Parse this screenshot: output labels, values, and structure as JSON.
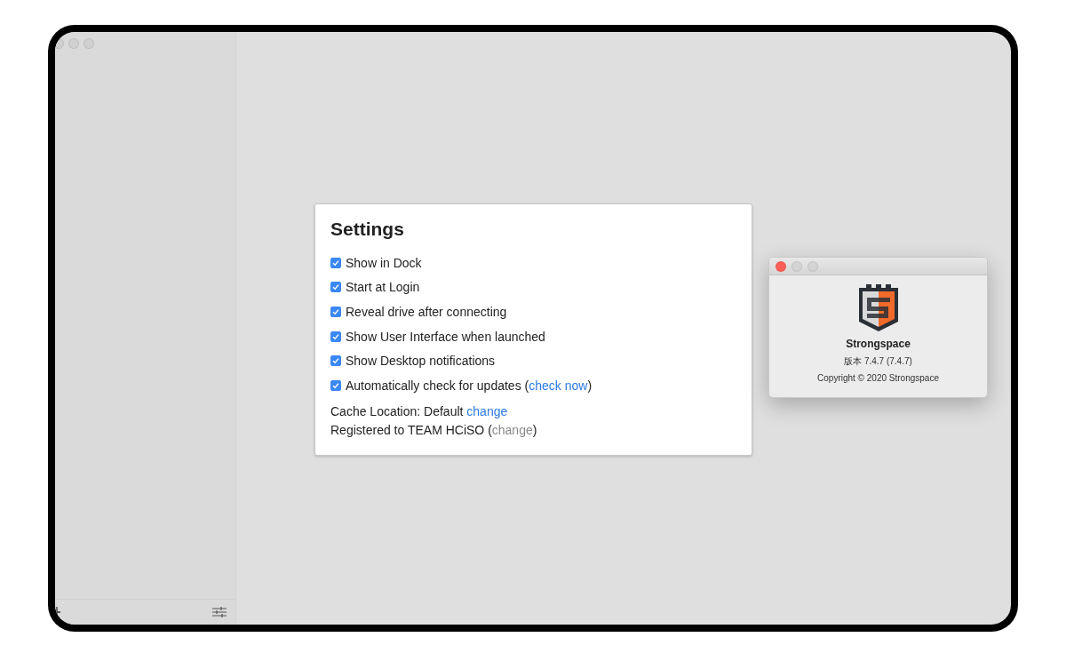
{
  "settings": {
    "title": "Settings",
    "options": [
      {
        "label": "Show in Dock",
        "checked": true
      },
      {
        "label": "Start at Login",
        "checked": true
      },
      {
        "label": "Reveal drive after connecting",
        "checked": true
      },
      {
        "label": "Show User Interface when launched",
        "checked": true
      },
      {
        "label": "Show Desktop notifications",
        "checked": true
      },
      {
        "label": "Automatically check for updates (",
        "link": "check now",
        "suffix": ")",
        "checked": true
      }
    ],
    "cache": {
      "label": "Cache Location: Default",
      "link": "change"
    },
    "registration": {
      "label": "Registered to TEAM HCiSO (",
      "link": "change",
      "suffix": ")",
      "link_disabled": true
    }
  },
  "about": {
    "app_name": "Strongspace",
    "version": "版本 7.4.7 (7.4.7)",
    "copyright": "Copyright © 2020 Strongspace"
  }
}
